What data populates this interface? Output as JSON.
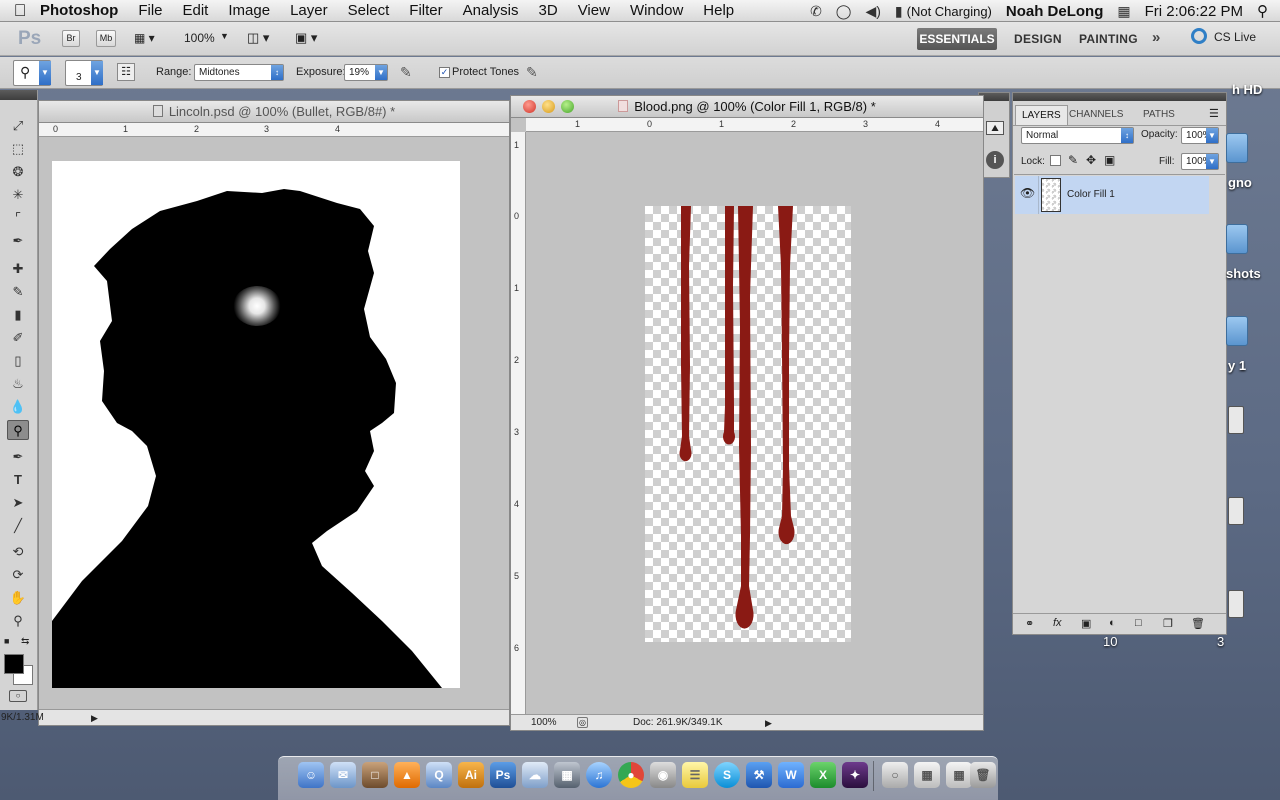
{
  "menubar": {
    "app_name": "Photoshop",
    "menus": [
      "File",
      "Edit",
      "Image",
      "Layer",
      "Select",
      "Filter",
      "Analysis",
      "3D",
      "View",
      "Window",
      "Help"
    ],
    "battery_status": "(Not Charging)",
    "user": "Noah DeLong",
    "clock": "Fri 2:06:22 PM"
  },
  "appbar": {
    "logo": "Ps",
    "bridge": "Br",
    "minibridge": "Mb",
    "zoom": "100%",
    "workspaces": [
      "ESSENTIALS",
      "DESIGN",
      "PAINTING"
    ],
    "cs_live": "CS Live"
  },
  "options": {
    "brush_size": "3",
    "range_label": "Range:",
    "range_value": "Midtones",
    "exposure_label": "Exposure:",
    "exposure_value": "19%",
    "protect_tones_label": "Protect Tones"
  },
  "doc1": {
    "title": "Lincoln.psd @ 100% (Bullet, RGB/8#) *",
    "ruler_labels": [
      "0",
      "1",
      "2",
      "3",
      "4"
    ],
    "status_size": "9K/1.31M"
  },
  "doc2": {
    "title": "Blood.png @ 100% (Color Fill 1, RGB/8) *",
    "ruler_h_labels": [
      "1",
      "0",
      "1",
      "2",
      "3",
      "4"
    ],
    "ruler_v_labels": [
      "1",
      "0",
      "1",
      "2",
      "3",
      "4",
      "5",
      "6"
    ],
    "zoom": "100%",
    "doc_size": "Doc: 261.9K/349.1K"
  },
  "layers_panel": {
    "tabs": [
      "LAYERS",
      "CHANNELS",
      "PATHS"
    ],
    "blend_mode": "Normal",
    "opacity_label": "Opacity:",
    "opacity_value": "100%",
    "lock_label": "Lock:",
    "fill_label": "Fill:",
    "fill_value": "100%",
    "layer_name": "Color Fill 1"
  },
  "desktop": {
    "labels": [
      "h HD",
      "gno",
      "shots",
      "y 1",
      "10",
      "3"
    ]
  },
  "colors": {
    "blood": "#8a1a14",
    "selection": "#c2d6f2",
    "foreground": "#000000",
    "background": "#ffffff"
  }
}
